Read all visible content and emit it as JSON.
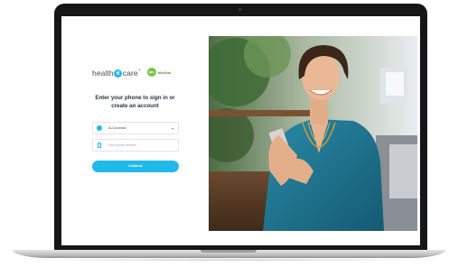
{
  "login": {
    "logo_text_before": "health",
    "logo_letter": "e",
    "logo_text_after": "care",
    "logo_mark": "+",
    "partner_logo_initials": "ipn",
    "partner_label": "Medical",
    "heading_line1": "Enter your phone to sign in or",
    "heading_line2": "create an account",
    "country_value": "AU Australia",
    "phone_placeholder": "Your phone number",
    "continue_label": "Continue"
  },
  "icons": {
    "country": "globe-icon",
    "chevron": "chevron-down-icon",
    "phone": "mobile-phone-icon"
  },
  "colors": {
    "accent": "#21b9e9",
    "partner": "#7cc242",
    "heading": "#2a3244",
    "device_frame": "#161616"
  }
}
